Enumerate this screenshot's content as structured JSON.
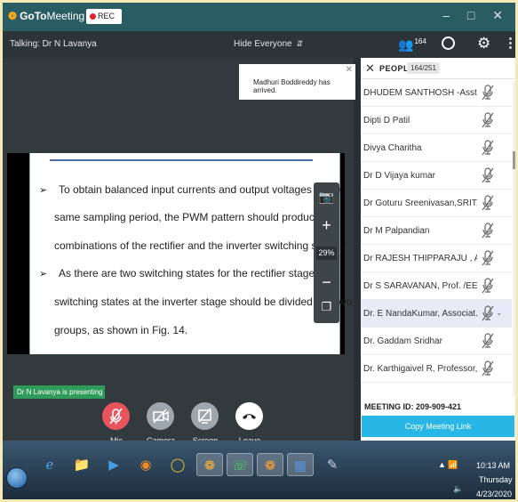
{
  "app": {
    "name_bold": "GoTo",
    "name_light": "Meeting",
    "rec_label": "REC",
    "window_controls": "– □ ✕"
  },
  "talkbar": {
    "talking": "Talking: Dr N Lavanya",
    "hide_everyone": "Hide Everyone",
    "people_count_badge": "164"
  },
  "toast": {
    "message": "Madhuri Boddireddy has arrived."
  },
  "slide": {
    "lines": [
      "To obtain balanced input currents and output voltages in the",
      "same sampling period, the PWM pattern should produce all",
      "combinations of the rectifier and the inverter switching states.",
      "As there are two switching states for the rectifier stage, the",
      "switching states at the inverter stage should be divided into two",
      "groups, as shown in Fig. 14."
    ],
    "bullet": "➢"
  },
  "zoom": {
    "percent": "29%"
  },
  "presenting": "Dr N Lavanya is presenting",
  "controls": {
    "mic": "Mic",
    "camera": "Camera",
    "screen": "Screen",
    "leave": "Leave"
  },
  "people": {
    "title": "PEOPLE",
    "count": "164/251",
    "list": [
      "DHUDEM SANTHOSH -Asst...",
      "Dipti D Patil",
      "Divya Charitha",
      "Dr  D Vijaya kumar",
      "Dr Goturu Sreenivasan,SRIT,...",
      "Dr M Palpandian",
      "Dr RAJESH THIPPARAJU , As...",
      "Dr S SARAVANAN,  Prof. /EE...",
      "Dr. E NandaKumar, Associat...",
      "Dr. Gaddam Sridhar",
      "Dr. Karthigaivel R, Professor,..."
    ],
    "selected_index": 8,
    "meeting_id": "MEETING ID:  209-909-421",
    "copy_link": "Copy Meeting Link"
  },
  "taskbar": {
    "time": "10:13 AM",
    "day": "Thursday",
    "date": "4/23/2020"
  },
  "colors": {
    "header": "#2a5c63",
    "mic_muted": "#e8545e",
    "accent_link": "#27b6e5",
    "presenting_badge": "#2f9b5a"
  }
}
